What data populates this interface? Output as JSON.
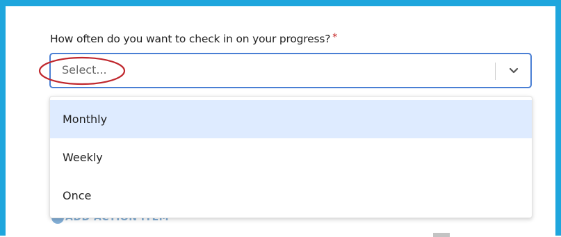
{
  "form": {
    "question": "How often do you want to check in on your progress?",
    "required_mark": "*",
    "select": {
      "placeholder": "Select...",
      "options": [
        "Monthly",
        "Weekly",
        "Once"
      ],
      "highlighted_option": "Monthly",
      "border_color": "#4a7fd4"
    }
  },
  "background": {
    "action_link": "ADD ACTION ITEM"
  },
  "colors": {
    "frame": "#1fa6dd",
    "highlight": "#deebff",
    "annotation": "#c0282e",
    "required": "#c62828"
  }
}
